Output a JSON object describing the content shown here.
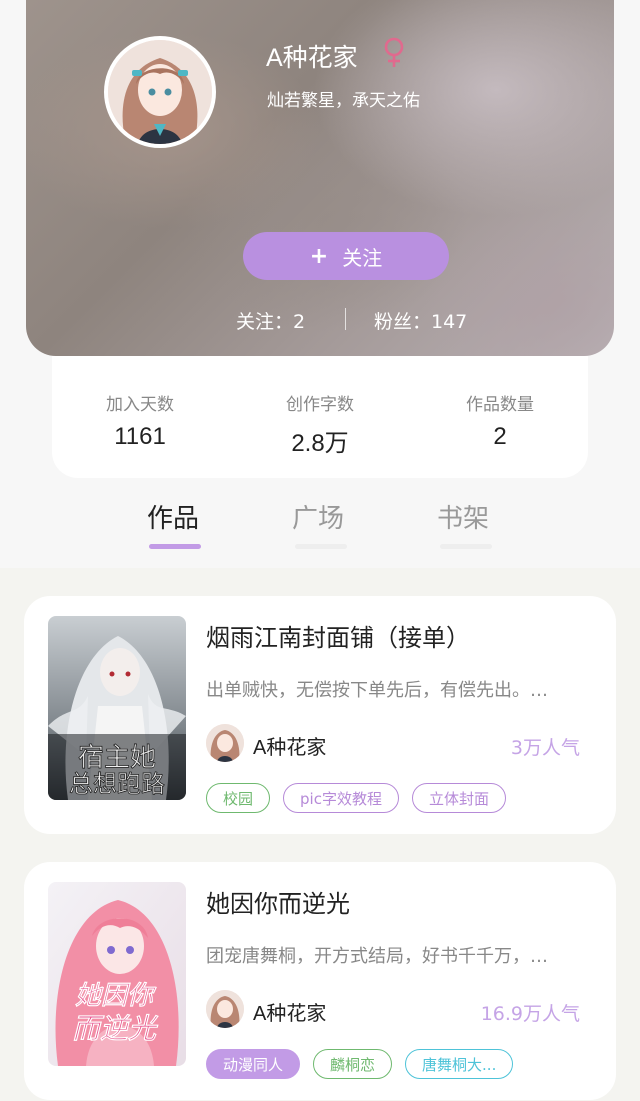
{
  "profile": {
    "name": "A种花家",
    "gender_icon": "female-icon",
    "motto": "灿若繁星，承天之佑",
    "follow_label": "关注",
    "follow_plus": "+",
    "following_text": "关注：2",
    "fans_text": "粉丝：147"
  },
  "stats": [
    {
      "label": "加入天数",
      "value": "1161"
    },
    {
      "label": "创作字数",
      "value": "2.8万"
    },
    {
      "label": "作品数量",
      "value": "2"
    }
  ],
  "tabs": [
    {
      "label": "作品",
      "active": true
    },
    {
      "label": "广场",
      "active": false
    },
    {
      "label": "书架",
      "active": false
    }
  ],
  "works": [
    {
      "title": "烟雨江南封面铺（接单）",
      "description": "出单贼快，无偿按下单先后，有偿先出。…",
      "author": "A种花家",
      "popularity": "3万人气",
      "tags": [
        {
          "label": "校园",
          "color": "#6fb96f"
        },
        {
          "label": "pic字效教程",
          "color": "#b68ad8"
        },
        {
          "label": "立体封面",
          "color": "#b68ad8"
        }
      ]
    },
    {
      "title": "她因你而逆光",
      "description": "团宠唐舞桐，开方式结局，好书千千万，…",
      "author": "A种花家",
      "popularity": "16.9万人气",
      "tags": [
        {
          "label": "动漫同人",
          "color": "#ffffff",
          "bg": "#c29be6"
        },
        {
          "label": "麟桐恋",
          "color": "#6fb96f"
        },
        {
          "label": "唐舞桐大...",
          "color": "#4ec3d8"
        }
      ]
    }
  ],
  "colors": {
    "accent": "#b990e0",
    "popularity": "#c5a4e6",
    "tab_indicator": "#c29be6"
  }
}
